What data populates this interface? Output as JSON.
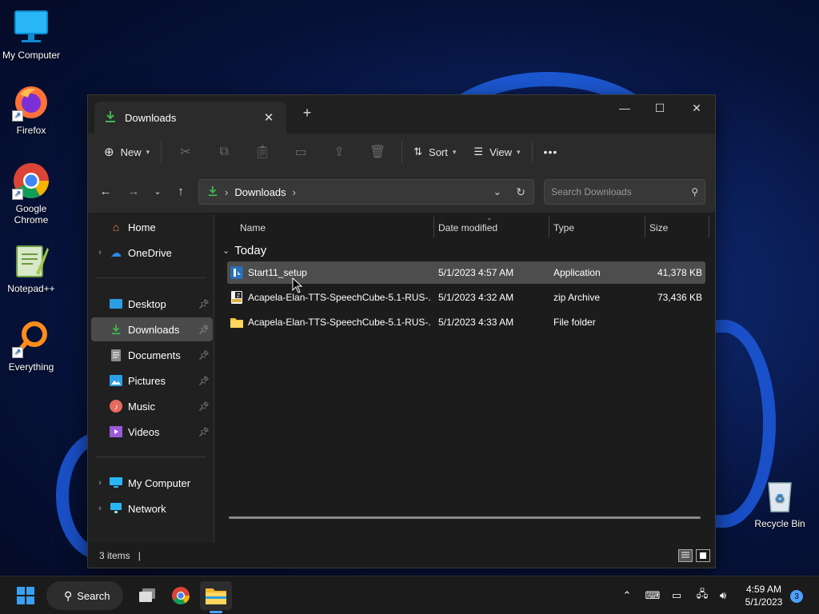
{
  "desktop": {
    "icons": [
      {
        "label": "My Computer"
      },
      {
        "label": "Firefox"
      },
      {
        "label": "Google Chrome"
      },
      {
        "label": "Notepad++"
      },
      {
        "label": "Everything"
      },
      {
        "label": "Recycle Bin"
      }
    ]
  },
  "window": {
    "tab_title": "Downloads",
    "tab_close": "✕",
    "new_tab": "+",
    "minimize": "—",
    "maximize": "☐",
    "close": "✕"
  },
  "toolbar": {
    "new_label": "New",
    "sort_label": "Sort",
    "view_label": "View",
    "more_label": "•••"
  },
  "address": {
    "crumb": "Downloads",
    "search_placeholder": "Search Downloads"
  },
  "nav": {
    "home": "Home",
    "onedrive": "OneDrive",
    "desktop": "Desktop",
    "downloads": "Downloads",
    "documents": "Documents",
    "pictures": "Pictures",
    "music": "Music",
    "videos": "Videos",
    "my_computer": "My Computer",
    "network": "Network"
  },
  "columns": {
    "name": "Name",
    "date": "Date modified",
    "type": "Type",
    "size": "Size"
  },
  "group": "Today",
  "files": [
    {
      "name": "Start11_setup",
      "date": "5/1/2023 4:57 AM",
      "type": "Application",
      "size": "41,378 KB"
    },
    {
      "name": "Acapela-Elan-TTS-SpeechCube-5.1-RUS-...",
      "date": "5/1/2023 4:32 AM",
      "type": "zip Archive",
      "size": "73,436 KB"
    },
    {
      "name": "Acapela-Elan-TTS-SpeechCube-5.1-RUS-...",
      "date": "5/1/2023 4:33 AM",
      "type": "File folder",
      "size": ""
    }
  ],
  "status": {
    "items": "3 items"
  },
  "taskbar": {
    "search_label": "Search",
    "time": "4:59 AM",
    "date": "5/1/2023",
    "notifications": "3"
  },
  "colors": {
    "accent": "#4ea1ff",
    "selection": "#4d4d4d",
    "download_green": "#3fb950"
  }
}
